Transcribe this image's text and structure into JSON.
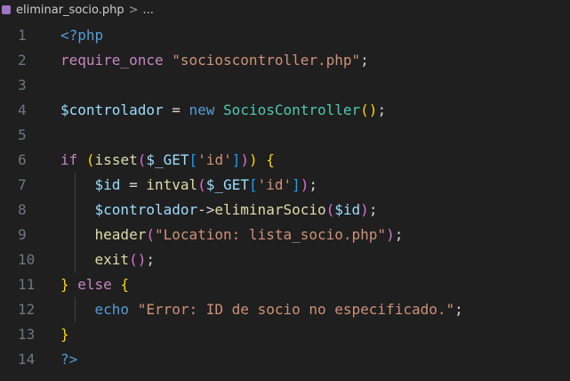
{
  "breadcrumb": {
    "file": "eliminar_socio.php",
    "separator": ">",
    "more": "..."
  },
  "editor": {
    "lines": [
      {
        "n": "1",
        "text": "<?php"
      },
      {
        "n": "2",
        "text": "require_once \"socioscontroller.php\";"
      },
      {
        "n": "3",
        "text": ""
      },
      {
        "n": "4",
        "text": "$controlador = new SociosController();"
      },
      {
        "n": "5",
        "text": ""
      },
      {
        "n": "6",
        "text": "if (isset($_GET['id'])) {"
      },
      {
        "n": "7",
        "text": "    $id = intval($_GET['id']);"
      },
      {
        "n": "8",
        "text": "    $controlador->eliminarSocio($id);"
      },
      {
        "n": "9",
        "text": "    header(\"Location: lista_socio.php\");"
      },
      {
        "n": "10",
        "text": "    exit();"
      },
      {
        "n": "11",
        "text": "} else {"
      },
      {
        "n": "12",
        "text": "    echo \"Error: ID de socio no especificado.\";"
      },
      {
        "n": "13",
        "text": "}"
      },
      {
        "n": "14",
        "text": "?>"
      }
    ]
  },
  "tokens": {
    "php_open": "<?php",
    "require_once": "require_once",
    "require_str": "\"socioscontroller.php\"",
    "semi": ";",
    "controlador": "$controlador",
    "assign": " = ",
    "new": "new",
    "SociosController": "SociosController",
    "if": "if",
    "isset": "isset",
    "GET": "$_GET",
    "id_key": "'id'",
    "id_var": "$id",
    "intval": "intval",
    "arrow": "->",
    "eliminarSocio": "eliminarSocio",
    "header": "header",
    "location_str": "\"Location: lista_socio.php\"",
    "exit": "exit",
    "else": "else",
    "echo": "echo",
    "error_str": "\"Error: ID de socio no especificado.\"",
    "php_close": "?>"
  },
  "colors": {
    "background": "#1f1f1f",
    "keyword_control": "#c586c0",
    "keyword": "#569cd6",
    "variable": "#9cdcfe",
    "string": "#ce9178",
    "function": "#dcdcaa",
    "class": "#4ec9b0",
    "line_number": "#6e7681"
  },
  "icons": {
    "file_icon": "php-file-icon"
  }
}
